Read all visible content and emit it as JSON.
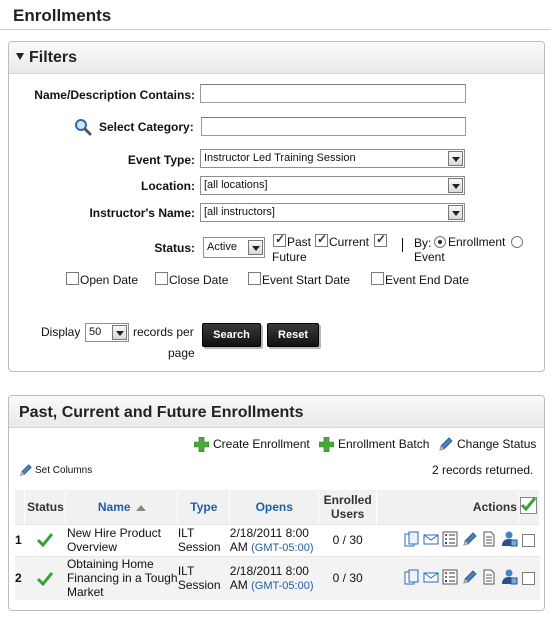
{
  "page": {
    "title": "Enrollments"
  },
  "filters": {
    "title": "Filters",
    "name_desc_label": "Name/Description Contains:",
    "name_desc_value": "",
    "category_label": "Select Category:",
    "category_value": "",
    "event_type_label": "Event Type:",
    "event_type_value": "Instructor Led Training Session",
    "location_label": "Location:",
    "location_value": "[all locations]",
    "instructor_label": "Instructor's Name:",
    "instructor_value": "[all instructors]",
    "status_label": "Status:",
    "status_value": "Active",
    "past_label": "Past",
    "current_label": "Current",
    "future_label": "Future",
    "by_label": "By:",
    "by_enrollment_label": "Enrollment",
    "by_event_label": "Event",
    "open_date_label": "Open Date",
    "close_date_label": "Close Date",
    "event_start_label": "Event Start Date",
    "event_end_label": "Event End Date",
    "display_label": "Display",
    "display_value": "50",
    "records_per_label": "records per",
    "page_label": "page",
    "search_button": "Search",
    "reset_button": "Reset"
  },
  "results": {
    "title": "Past, Current and Future Enrollments",
    "create_enrollment": "Create Enrollment",
    "enrollment_batch": "Enrollment Batch",
    "change_status": "Change Status",
    "set_columns": "Set Columns",
    "records_returned": "2 records returned.",
    "columns": {
      "status": "Status",
      "name": "Name",
      "type": "Type",
      "opens": "Opens",
      "enrolled_line1": "Enrolled",
      "enrolled_line2": "Users",
      "actions": "Actions"
    },
    "rows": [
      {
        "num": "1",
        "name": "New Hire Product Overview",
        "type": "ILT Session",
        "opens_date": "2/18/2011 8:00",
        "opens_time": "AM",
        "tz": "(GMT-05:00)",
        "enrolled": "0 / 30"
      },
      {
        "num": "2",
        "name": "Obtaining Home Financing in a Tough Market",
        "type": "ILT Session",
        "opens_date": "2/18/2011 8:00",
        "opens_time": "AM",
        "tz": "(GMT-05:00)",
        "enrolled": "0 / 30"
      }
    ]
  },
  "colors": {
    "link": "#1f5fa6",
    "green_check": "#3aa13a",
    "button_dark": "#1a1a1a"
  }
}
